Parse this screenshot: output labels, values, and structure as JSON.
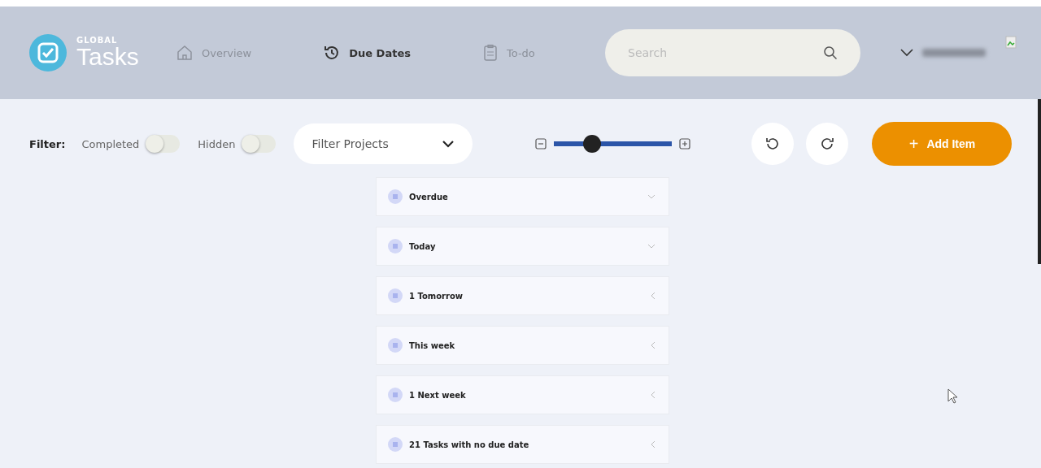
{
  "logo": {
    "small": "GLOBAL",
    "large": "Tasks"
  },
  "nav": [
    {
      "label": "Overview",
      "selected": false,
      "kind": "home"
    },
    {
      "label": "Due Dates",
      "selected": true,
      "kind": "history"
    },
    {
      "label": "To-do",
      "selected": false,
      "kind": "clipboard"
    }
  ],
  "search": {
    "placeholder": "Search"
  },
  "filter": {
    "label": "Filter:",
    "toggles": [
      {
        "label": "Completed",
        "checked": false
      },
      {
        "label": "Hidden",
        "checked": false
      }
    ],
    "projects": {
      "value": "Filter Projects"
    }
  },
  "zoom": {
    "level": 0.32
  },
  "add_button": {
    "label": "Add Item",
    "icon": "+"
  },
  "sections": [
    {
      "label": "Overdue",
      "expanded": true
    },
    {
      "label": "Today",
      "expanded": true
    },
    {
      "label": "1 Tomorrow",
      "expanded": false
    },
    {
      "label": "This week",
      "expanded": false
    },
    {
      "label": "1 Next week",
      "expanded": false
    },
    {
      "label": "21 Tasks with no due date",
      "expanded": false
    }
  ]
}
